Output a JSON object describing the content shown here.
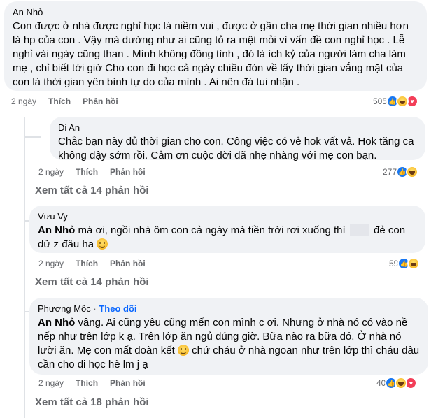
{
  "comments": [
    {
      "author": "An Nhỏ",
      "text": "Con được ở nhà được nghỉ học là niềm vui , được ở gần cha mẹ thời gian nhiều hơn là hp của con . Vậy mà dường như ai cũng tỏ ra mệt mỏi vì vấn đề con nghỉ học . Lễ nghỉ vài ngày cũng than . Mình không đồng tình , đó là ích kỷ của người làm cha làm mẹ , chỉ biết tới giờ Cho con đi học cả ngày chiều đón về lấy thời gian vắng mặt của con là thời gian yên bình tự do của mình . Ai nên đá tui nhận .",
      "time": "2 ngày",
      "like": "Thích",
      "reply": "Phản hồi",
      "reaction_count": "505",
      "reactions": [
        "like-icon",
        "haha-icon",
        "love-icon"
      ]
    },
    {
      "author": "Di An",
      "text": "Chắc bạn này đủ thời gian cho con. Công việc có vẻ hok vất vả. Hok tăng ca không dậy sớm rồi. Cảm ơn cuộc đời đã nhẹ nhàng với mẹ con bạn.",
      "time": "2 ngày",
      "like": "Thích",
      "reply": "Phản hồi",
      "reaction_count": "277",
      "reactions": [
        "like-icon",
        "haha-icon"
      ],
      "see_more": "Xem tất cả 14 phản hồi"
    },
    {
      "author": "Vưu Vy",
      "mention": "An Nhỏ",
      "text_a": " má ơi, ngồi nhà ôm con cả ngày mà tiền trời rơi xuống thì",
      "text_b": "đẻ con dữ z đâu ha",
      "time": "2 ngày",
      "like": "Thích",
      "reply": "Phản hồi",
      "reaction_count": "59",
      "reactions": [
        "like-icon",
        "haha-icon"
      ],
      "see_more": "Xem tất cả 14 phản hồi"
    },
    {
      "author": "Phương Mốc",
      "separator": "·",
      "follow": "Theo dõi",
      "mention": "An Nhỏ",
      "text_a": " vâng. Ai cũng yêu cũng mến con mình c ơi. Nhưng ở nhà nó có vào nề nếp như trên lớp k ạ. Trên lớp ăn ngủ đúng giờ. Bữa nào ra bữa đó. Ở nhà nó lười ăn. Mẹ con mất đoàn kết",
      "text_b": " chứ cháu ở nhà ngoan như trên lớp thì cháu đâu cần cho đi học hè lm j ạ",
      "time": "2 ngày",
      "like": "Thích",
      "reply": "Phản hồi",
      "reaction_count": "40",
      "reactions": [
        "like-icon",
        "haha-icon",
        "love-icon"
      ],
      "see_more": "Xem tất cả 18 phản hồi"
    }
  ]
}
